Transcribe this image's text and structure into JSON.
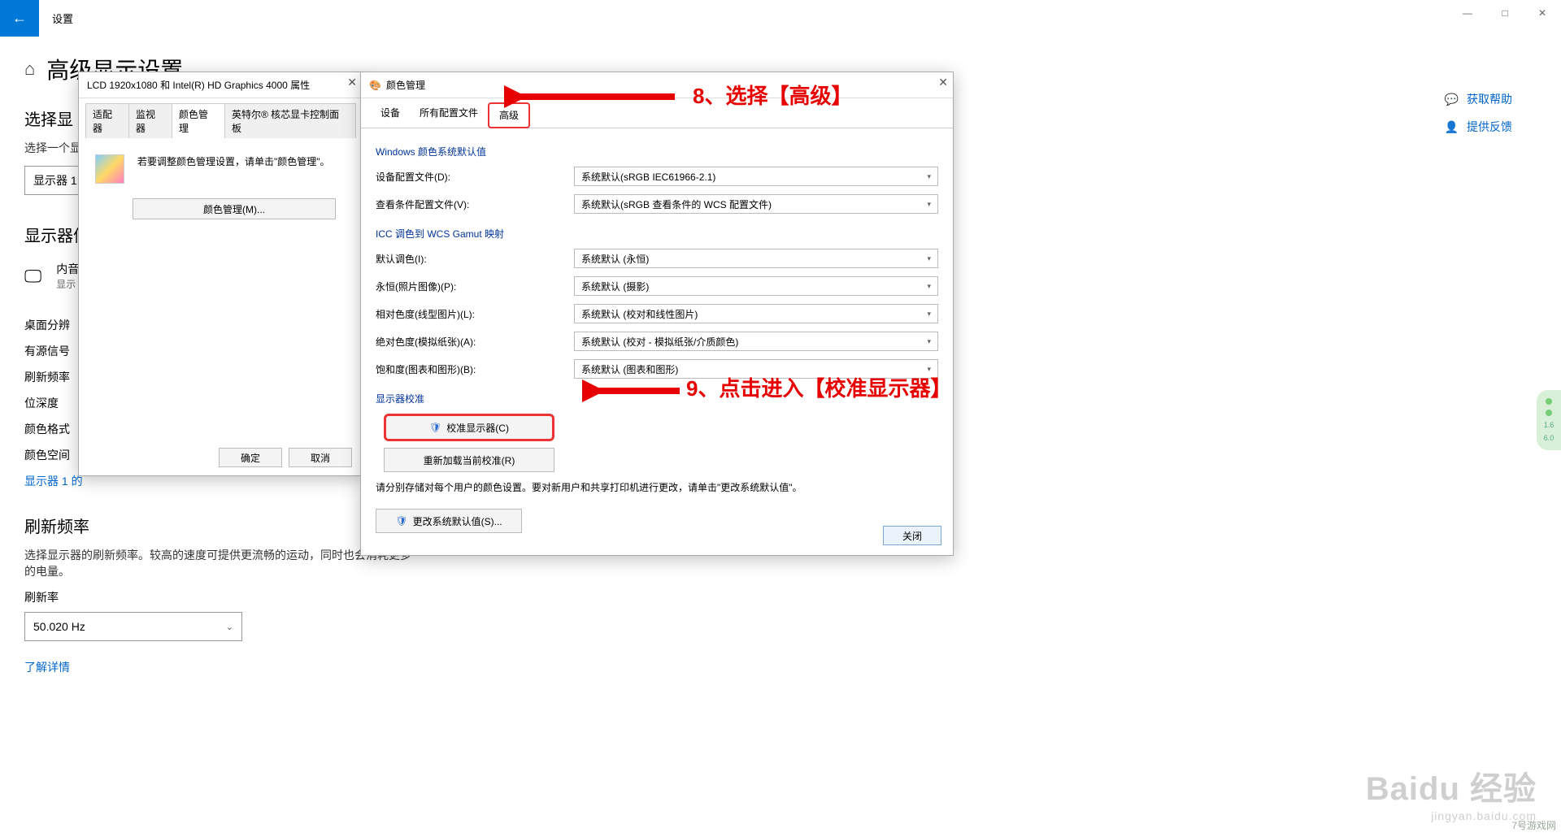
{
  "settings": {
    "title": "设置",
    "pageTitle": "高级显示设置",
    "selectDisplayHeader": "选择显",
    "selectDisplayText": "选择一个显",
    "displaySelector": "显示器 1:",
    "displayInfoHeader": "显示器信",
    "internalDisplay": "内音",
    "internalDisplaySub": "显示",
    "rows": [
      "桌面分辨",
      "有源信号",
      "刷新频率",
      "位深度",
      "颜色格式",
      "颜色空间"
    ],
    "displayLink": "显示器 1 的",
    "refreshHeader": "刷新频率",
    "refreshText": "选择显示器的刷新频率。较高的速度可提供更流畅的运动，同时也会消耗更多的电量。",
    "refreshLabel": "刷新率",
    "refreshValue": "50.020 Hz",
    "detailsLink": "了解详情",
    "helpLink": "获取帮助",
    "feedbackLink": "提供反馈"
  },
  "winControls": {
    "min": "—",
    "max": "□",
    "close": "✕"
  },
  "propsDialog": {
    "title": "LCD 1920x1080 和 Intel(R) HD Graphics 4000 属性",
    "tabs": [
      "适配器",
      "监视器",
      "颜色管理",
      "英特尔® 核芯显卡控制面板"
    ],
    "infoText": "若要调整颜色管理设置，请单击\"颜色管理\"。",
    "colorMgmtBtn": "颜色管理(M)...",
    "ok": "确定",
    "cancel": "取消"
  },
  "colorDialog": {
    "title": "颜色管理",
    "tabs": [
      "设备",
      "所有配置文件",
      "高级"
    ],
    "group1Title": "Windows 颜色系统默认值",
    "rows1": [
      {
        "label": "设备配置文件(D):",
        "value": "系统默认(sRGB IEC61966-2.1)"
      },
      {
        "label": "查看条件配置文件(V):",
        "value": "系统默认(sRGB 查看条件的 WCS 配置文件)"
      }
    ],
    "group2Title": "ICC 调色到 WCS Gamut 映射",
    "rows2": [
      {
        "label": "默认调色(I):",
        "value": "系统默认 (永恒)"
      },
      {
        "label": "永恒(照片图像)(P):",
        "value": "系统默认 (摄影)"
      },
      {
        "label": "相对色度(线型图片)(L):",
        "value": "系统默认 (校对和线性图片)"
      },
      {
        "label": "绝对色度(模拟纸张)(A):",
        "value": "系统默认 (校对 - 模拟纸张/介质颜色)"
      },
      {
        "label": "饱和度(图表和图形)(B):",
        "value": "系统默认 (图表和图形)"
      }
    ],
    "group3Title": "显示器校准",
    "calibrateBtn": "校准显示器(C)",
    "reloadBtn": "重新加载当前校准(R)",
    "note": "请分别存储对每个用户的颜色设置。要对新用户和共享打印机进行更改，请单击\"更改系统默认值\"。",
    "changeSysBtn": "更改系统默认值(S)...",
    "closeBtn": "关闭"
  },
  "annotations": {
    "a8": "8、选择【高级】",
    "a9": "9、点击进入【校准显示器】"
  },
  "watermark": {
    "big": "Baidu 经验",
    "small": "jingyan.baidu.com"
  },
  "cornerLogo": "7号游戏网",
  "sideWidget": {
    "v1": "1.6",
    "v2": "6.0"
  }
}
